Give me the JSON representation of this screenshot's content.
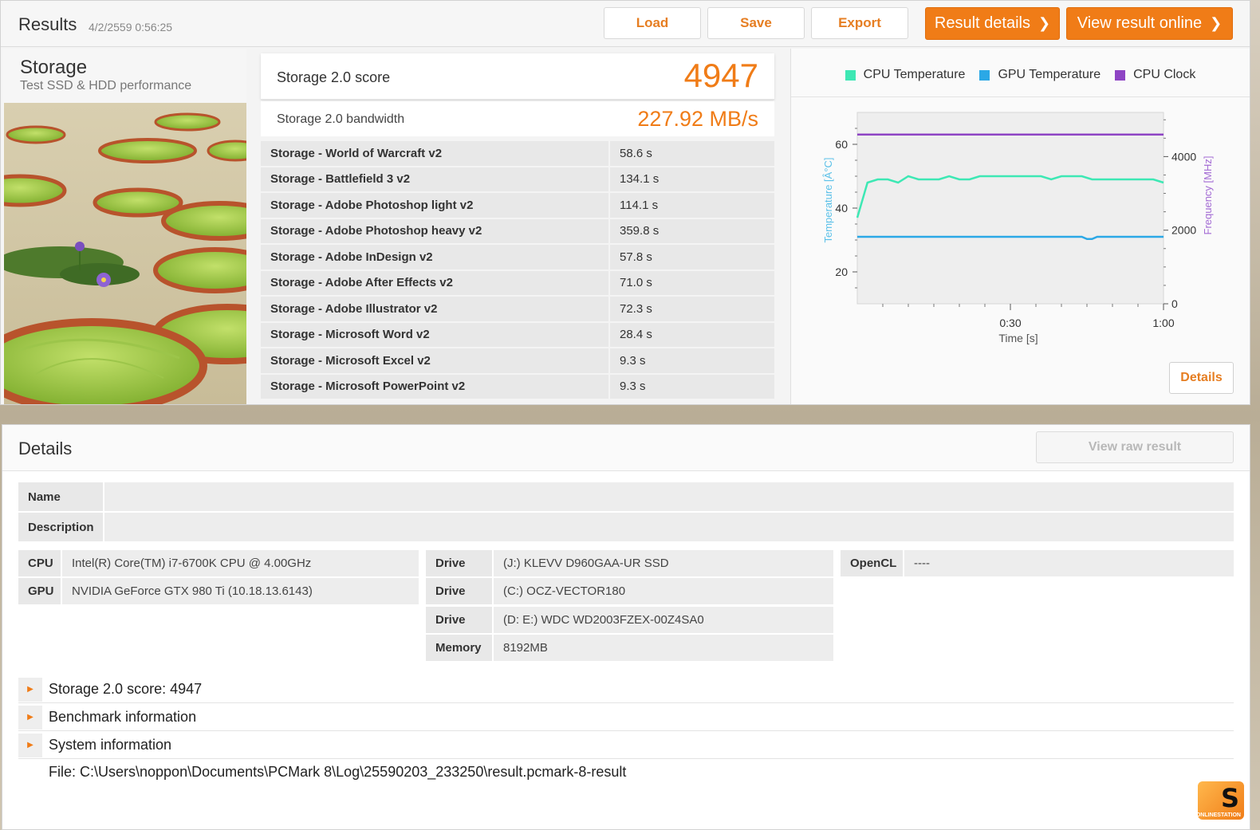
{
  "header": {
    "title": "Results",
    "date": "4/2/2559 0:56:25",
    "load_label": "Load",
    "save_label": "Save",
    "export_label": "Export",
    "result_details_label": "Result details",
    "view_online_label": "View result online"
  },
  "test": {
    "name": "Storage",
    "subtitle": "Test SSD & HDD performance"
  },
  "score": {
    "label": "Storage 2.0 score",
    "value": "4947",
    "bandwidth_label": "Storage 2.0 bandwidth",
    "bandwidth_value": "227.92 MB/s"
  },
  "subtests": [
    {
      "name": "Storage - World of Warcraft v2",
      "value": "58.6 s"
    },
    {
      "name": "Storage - Battlefield 3 v2",
      "value": "134.1 s"
    },
    {
      "name": "Storage - Adobe Photoshop light v2",
      "value": "114.1 s"
    },
    {
      "name": "Storage - Adobe Photoshop heavy v2",
      "value": "359.8 s"
    },
    {
      "name": "Storage - Adobe InDesign v2",
      "value": "57.8 s"
    },
    {
      "name": "Storage - Adobe After Effects v2",
      "value": "71.0 s"
    },
    {
      "name": "Storage - Adobe Illustrator v2",
      "value": "72.3 s"
    },
    {
      "name": "Storage - Microsoft Word v2",
      "value": "28.4 s"
    },
    {
      "name": "Storage - Microsoft Excel v2",
      "value": "9.3 s"
    },
    {
      "name": "Storage - Microsoft PowerPoint v2",
      "value": "9.3 s"
    }
  ],
  "chart_data": {
    "type": "line",
    "xlabel": "Time [s]",
    "ylabel_left": "Temperature [Â°C]",
    "ylabel_right": "Frequency [MHz]",
    "x_ticks": [
      "0:30",
      "1:00"
    ],
    "x_range_seconds": [
      0,
      60
    ],
    "y_left_ticks": [
      20,
      40,
      60
    ],
    "y_left_range": [
      10,
      70
    ],
    "y_right_ticks": [
      0,
      2000,
      4000
    ],
    "y_right_range": [
      0,
      5200
    ],
    "legend_position": "top",
    "series": [
      {
        "name": "CPU Temperature",
        "color": "#3de8b4",
        "axis": "left",
        "x": [
          0,
          2,
          4,
          6,
          8,
          10,
          12,
          14,
          16,
          18,
          20,
          22,
          24,
          26,
          28,
          30,
          32,
          34,
          36,
          38,
          40,
          42,
          44,
          46,
          48,
          50,
          52,
          54,
          56,
          58,
          60
        ],
        "y": [
          37,
          48,
          49,
          49,
          48,
          50,
          49,
          49,
          49,
          50,
          49,
          49,
          50,
          50,
          50,
          50,
          50,
          50,
          50,
          49,
          50,
          50,
          50,
          49,
          49,
          49,
          49,
          49,
          49,
          49,
          48
        ]
      },
      {
        "name": "GPU Temperature",
        "color": "#2ba8e6",
        "axis": "left",
        "x": [
          0,
          10,
          20,
          30,
          40,
          44,
          45,
          46,
          47,
          50,
          60
        ],
        "y": [
          31,
          31,
          31,
          31,
          31,
          31,
          30.3,
          30.3,
          31,
          31,
          31
        ]
      },
      {
        "name": "CPU Clock",
        "color": "#8e44c4",
        "axis": "right",
        "x": [
          0,
          10,
          20,
          30,
          40,
          50,
          60
        ],
        "y": [
          4600,
          4600,
          4600,
          4600,
          4600,
          4600,
          4600
        ]
      }
    ]
  },
  "chart_ui": {
    "details_label": "Details"
  },
  "details": {
    "title": "Details",
    "raw_label": "View raw result",
    "name_key": "Name",
    "name_value": "",
    "description_key": "Description",
    "description_value": "",
    "cpu_key": "CPU",
    "cpu_value": "Intel(R) Core(TM) i7-6700K CPU @ 4.00GHz",
    "gpu_key": "GPU",
    "gpu_value": "NVIDIA GeForce GTX 980 Ti (10.18.13.6143)",
    "drives": [
      {
        "key": "Drive",
        "value": "(J:) KLEVV D960GAA-UR SSD"
      },
      {
        "key": "Drive",
        "value": "(C:) OCZ-VECTOR180"
      },
      {
        "key": "Drive",
        "value": "(D: E:) WDC WD2003FZEX-00Z4SA0"
      }
    ],
    "memory_key": "Memory",
    "memory_value": "8192MB",
    "opencl_key": "OpenCL",
    "opencl_value": "----",
    "sections": [
      "Storage 2.0 score: 4947",
      "Benchmark information",
      "System information"
    ],
    "file_path": "File: C:\\Users\\noppon\\Documents\\PCMark 8\\Log\\25590203_233250\\result.pcmark-8-result"
  },
  "watermark": {
    "letter": "S",
    "text": "ONLINESTATION"
  }
}
